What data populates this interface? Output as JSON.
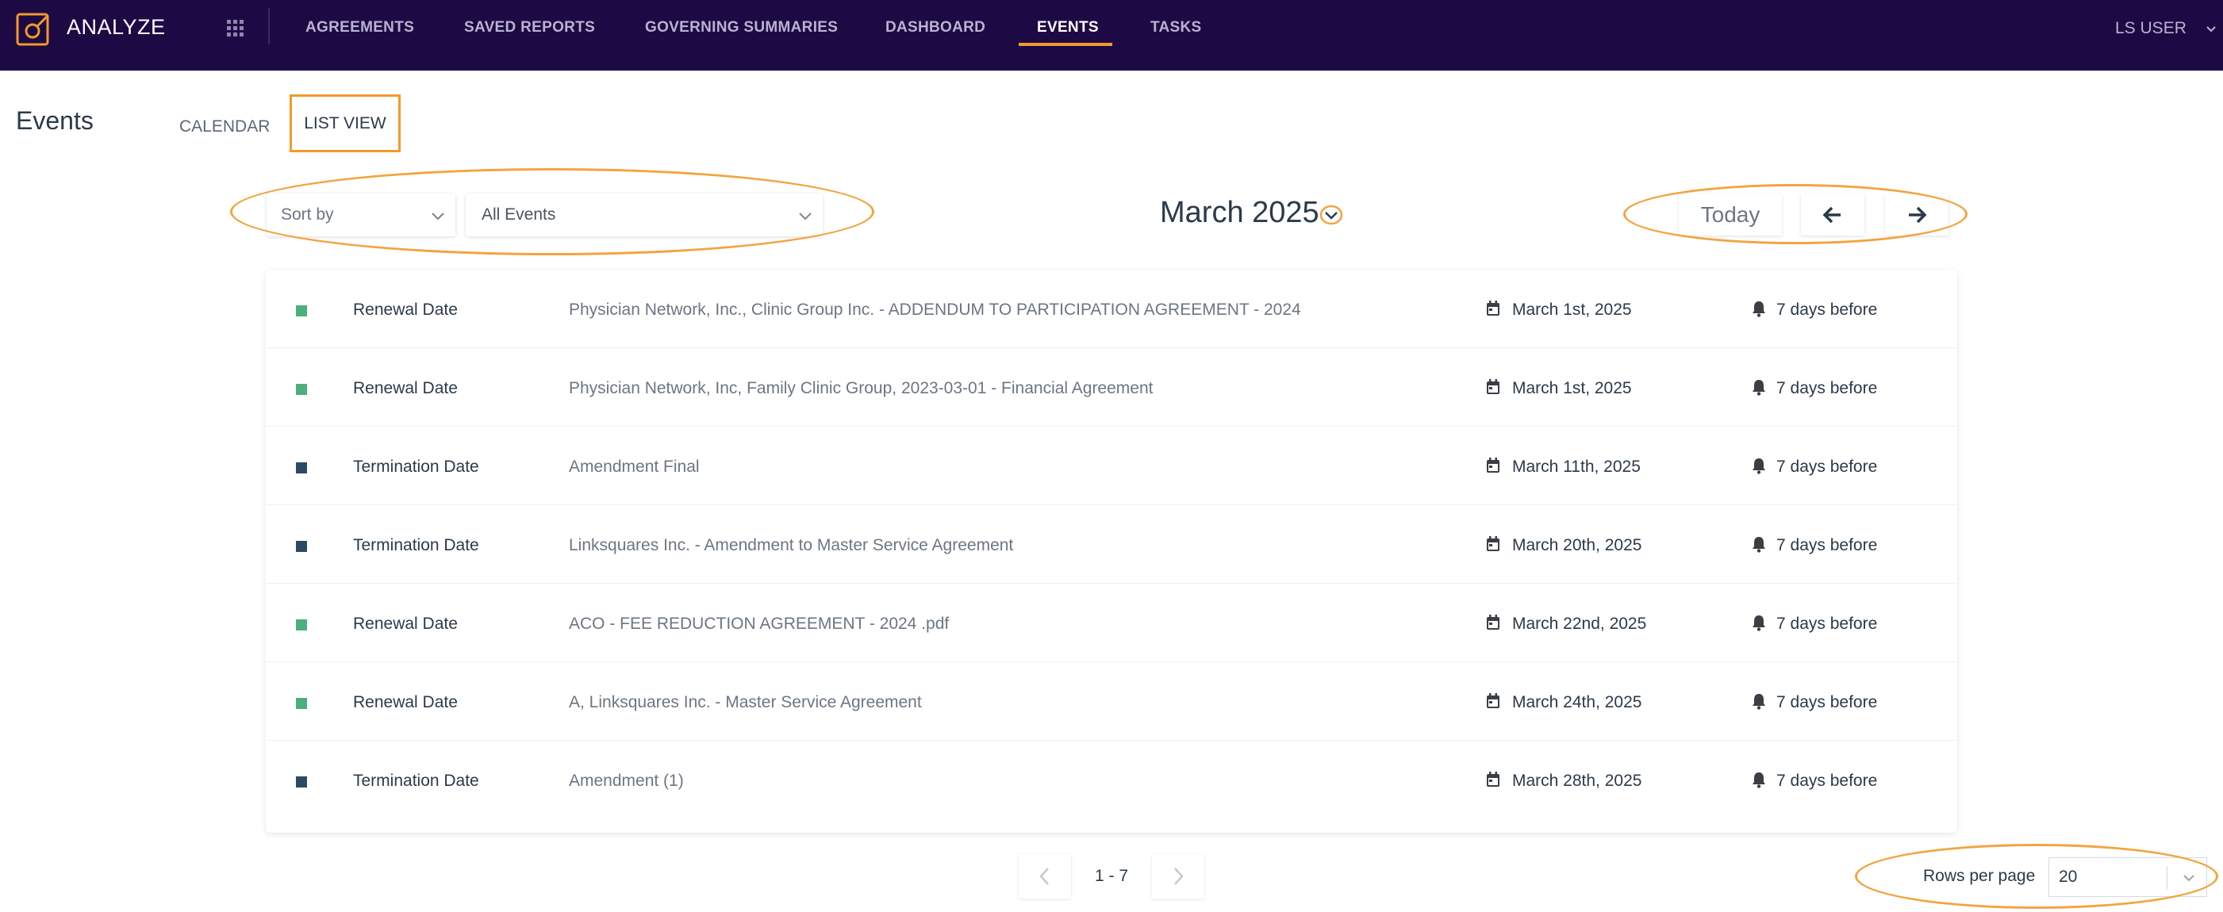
{
  "app": {
    "brand": "ANALYZE"
  },
  "nav": {
    "items": [
      {
        "label": "AGREEMENTS"
      },
      {
        "label": "SAVED REPORTS"
      },
      {
        "label": "GOVERNING SUMMARIES"
      },
      {
        "label": "DASHBOARD"
      },
      {
        "label": "EVENTS",
        "active": true
      },
      {
        "label": "TASKS"
      }
    ],
    "user": "LS USER"
  },
  "page": {
    "title": "Events",
    "tabs": [
      {
        "label": "CALENDAR"
      },
      {
        "label": "LIST VIEW",
        "active": true
      }
    ]
  },
  "filters": {
    "sort_by": "Sort by",
    "event_filter": "All Events"
  },
  "calendar_nav": {
    "month": "March 2025",
    "today": "Today"
  },
  "colors": {
    "renewal": "#4caf7d",
    "termination": "#2c4a63",
    "accent": "#f39a2b",
    "topbar": "#1d0a45"
  },
  "events": [
    {
      "type": "Renewal Date",
      "kind": "renewal",
      "title": "Physician Network, Inc., Clinic Group Inc. - ADDENDUM TO PARTICIPATION AGREEMENT - 2024",
      "date": "March 1st, 2025",
      "reminder": "7 days before"
    },
    {
      "type": "Renewal Date",
      "kind": "renewal",
      "title": "Physician Network, Inc, Family Clinic Group, 2023-03-01 - Financial Agreement",
      "date": "March 1st, 2025",
      "reminder": "7 days before"
    },
    {
      "type": "Termination Date",
      "kind": "termination",
      "title": "Amendment Final",
      "date": "March 11th, 2025",
      "reminder": "7 days before"
    },
    {
      "type": "Termination Date",
      "kind": "termination",
      "title": "Linksquares Inc. - Amendment to Master Service Agreement",
      "date": "March 20th, 2025",
      "reminder": "7 days before"
    },
    {
      "type": "Renewal Date",
      "kind": "renewal",
      "title": "ACO - FEE REDUCTION AGREEMENT - 2024 .pdf",
      "date": "March 22nd, 2025",
      "reminder": "7 days before"
    },
    {
      "type": "Renewal Date",
      "kind": "renewal",
      "title": "A, Linksquares Inc. - Master Service Agreement",
      "date": "March 24th, 2025",
      "reminder": "7 days before"
    },
    {
      "type": "Termination Date",
      "kind": "termination",
      "title": "Amendment (1)",
      "date": "March 28th, 2025",
      "reminder": "7 days before"
    }
  ],
  "pagination": {
    "range": "1 - 7",
    "rows_per_page_label": "Rows per page",
    "rows_per_page": "20"
  }
}
